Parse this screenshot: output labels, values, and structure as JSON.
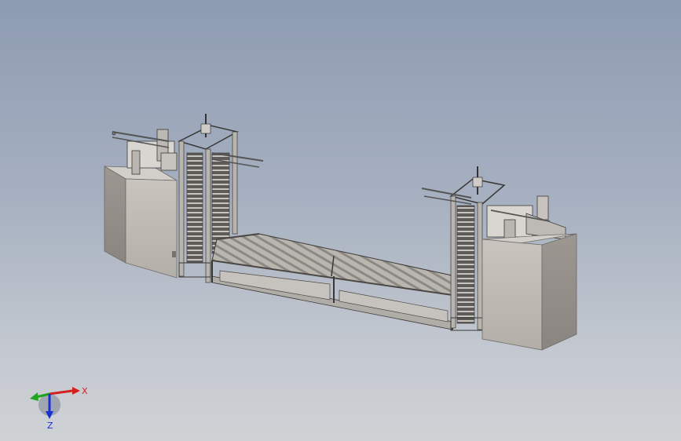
{
  "view": {
    "background_top": "#8d9bb1",
    "background_bottom": "#cfd2d5",
    "model_description_hidden": ""
  },
  "triad": {
    "x_label": "X",
    "z_label": "Z",
    "x_color": "#d42020",
    "y_color": "#1fa51f",
    "z_color": "#1a2fd0"
  }
}
